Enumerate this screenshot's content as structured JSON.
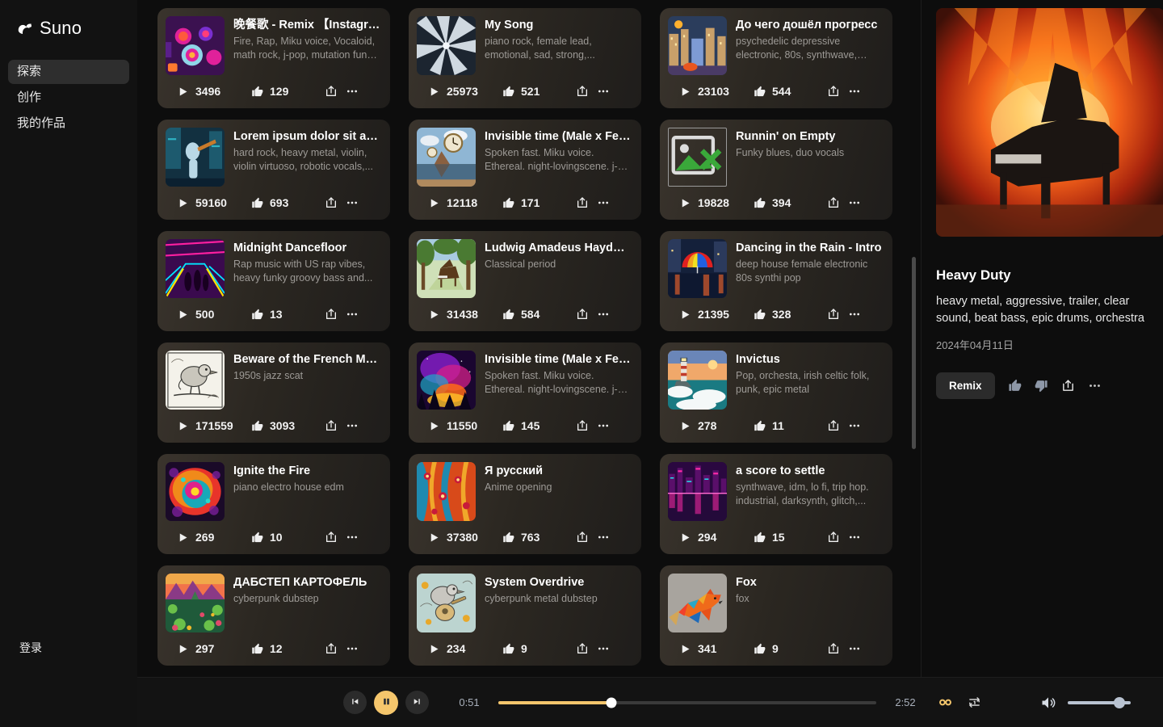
{
  "brand": {
    "name": "Suno",
    "logo_icon": "suno-logo-icon"
  },
  "sidebar": {
    "items": [
      {
        "label": "探索",
        "name": "explore",
        "active": true
      },
      {
        "label": "创作",
        "name": "create",
        "active": false
      },
      {
        "label": "我的作品",
        "name": "my-works",
        "active": false
      }
    ],
    "login_label": "登录"
  },
  "feed": {
    "cards": [
      {
        "title": "晚餐歌 - Remix 【Instagram:A...",
        "tags": "Fire, Rap, Miku voice, Vocaloid, math rock, j-pop, mutation funk, bounce...",
        "plays": "3496",
        "likes": "129",
        "art": "dinner-table-neon"
      },
      {
        "title": "My Song",
        "tags": "piano rock, female lead, emotional, sad, strong,...",
        "plays": "25973",
        "likes": "521",
        "art": "shattered-glass"
      },
      {
        "title": "До чего дошёл прогресс",
        "tags": "psychedelic depressive electronic, 80s, synthwave, pos...",
        "plays": "23103",
        "likes": "544",
        "art": "city-street-colorful"
      },
      {
        "title": "Lorem ipsum dolor sit amet",
        "tags": "hard rock, heavy metal, violin, violin virtuoso, robotic vocals,...",
        "plays": "59160",
        "likes": "693",
        "art": "violinist-cyber"
      },
      {
        "title": "Invisible time (Male x Female ...",
        "tags": "Spoken fast. Miku voice. Ethereal. night-lovingscene. j-pop. indie-rock....",
        "plays": "12118",
        "likes": "171",
        "art": "clock-desert"
      },
      {
        "title": "Runnin' on Empty",
        "tags": "Funky blues, duo vocals",
        "plays": "19828",
        "likes": "394",
        "art": "broken-image"
      },
      {
        "title": "Midnight Dancefloor",
        "tags": "Rap music with US rap vibes, heavy funky groovy bass and...",
        "plays": "500",
        "likes": "13",
        "art": "neon-club"
      },
      {
        "title": "Ludwig Amadeus Haydn - Pia...",
        "tags": "Classical period",
        "plays": "31438",
        "likes": "584",
        "art": "piano-forest"
      },
      {
        "title": "Dancing in the Rain - Intro",
        "tags": "deep house female electronic 80s synthi pop",
        "plays": "21395",
        "likes": "328",
        "art": "rainbow-umbrella"
      },
      {
        "title": "Beware of the French Men an...",
        "tags": "1950s jazz scat",
        "plays": "171559",
        "likes": "3093",
        "art": "bird-engraving"
      },
      {
        "title": "Invisible time (Male x Female ...",
        "tags": "Spoken fast. Miku voice. Ethereal. night-lovingscene. j-pop. indie-rock....",
        "plays": "11550",
        "likes": "145",
        "art": "nebula-forest"
      },
      {
        "title": "Invictus",
        "tags": "Pop, orchesta, irish celtic folk, punk, epic metal",
        "plays": "278",
        "likes": "11",
        "art": "lighthouse"
      },
      {
        "title": "Ignite the Fire",
        "tags": "piano electro house edm",
        "plays": "269",
        "likes": "10",
        "art": "psychedelic-bloom"
      },
      {
        "title": "Я русский",
        "tags": "Anime opening",
        "plays": "37380",
        "likes": "763",
        "art": "orange-swirl"
      },
      {
        "title": "a score to settle",
        "tags": "synthwave, idm, lo fi, trip hop. industrial, darksynth, glitch,...",
        "plays": "294",
        "likes": "15",
        "art": "synthwave-city"
      },
      {
        "title": "ДАБСТЕП КАРТОФЕЛЬ",
        "tags": "cyberpunk dubstep",
        "plays": "297",
        "likes": "12",
        "art": "veggie-mountain"
      },
      {
        "title": "System Overdrive",
        "tags": "cyberpunk metal dubstep",
        "plays": "234",
        "likes": "9",
        "art": "bird-guitar"
      },
      {
        "title": "Fox",
        "tags": "fox",
        "plays": "341",
        "likes": "9",
        "art": "fox-lowpoly"
      }
    ],
    "play_icon": "play-icon",
    "like_icon": "thumbs-up-icon",
    "share_icon": "share-icon",
    "more_icon": "more-options-icon"
  },
  "detail": {
    "art": "burning-piano",
    "title": "Heavy Duty",
    "tags": "heavy metal, aggressive, trailer, clear sound, beat bass, epic drums, orchestra",
    "date": "2024年04月11日",
    "remix_label": "Remix",
    "like_icon": "thumbs-up-icon",
    "dislike_icon": "thumbs-down-icon",
    "share_icon": "share-icon",
    "more_icon": "more-options-icon"
  },
  "player": {
    "prev_icon": "skip-previous-icon",
    "pause_icon": "pause-icon",
    "next_icon": "skip-next-icon",
    "current_time": "0:51",
    "total_time": "2:52",
    "progress_percent": 30,
    "infinity_icon": "infinity-icon",
    "repeat_icon": "repeat-one-icon",
    "volume_icon": "volume-high-icon",
    "volume_percent": 82
  },
  "colors": {
    "accent": "#f5c66c",
    "background": "#0d0d0d",
    "sidebar": "#121212",
    "card_start": "#3a342d",
    "text_muted": "#9d9a96"
  }
}
